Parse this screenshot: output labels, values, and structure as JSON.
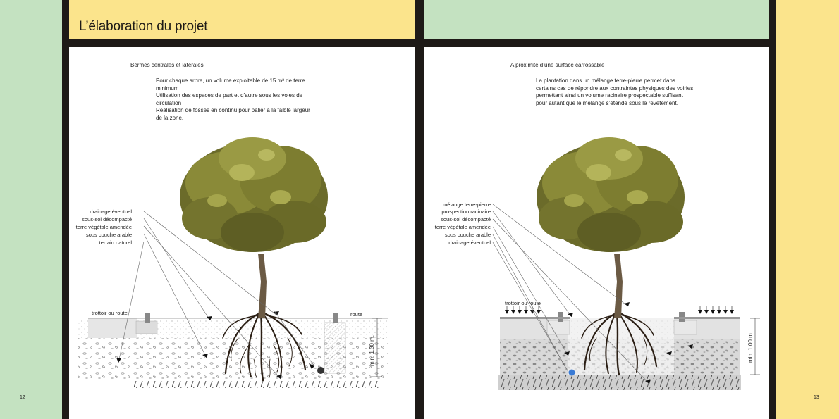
{
  "header": {
    "title": "L’élaboration du projet"
  },
  "left_page": {
    "subtitle": "Bermes centrales et latérales",
    "bullets": [
      "Pour chaque arbre, un volume exploitable de 15 m³ de terre",
      "minimum",
      "Utilisation des espaces de part et d’autre sous les voies de",
      "circulation",
      "Réalisation de fosses en continu pour palier à la faible largeur",
      "de la zone."
    ],
    "diagram_labels": {
      "drainage": "drainage éventuel",
      "sous_sol": "sous-sol décompacté",
      "terre_vegetale": "terre végétale amendée",
      "sous_couche": "sous couche arable",
      "terrain": "terrain naturel",
      "trottoir": "trottoir ou route",
      "route": "route",
      "depth": "min. 1.00 m."
    },
    "page_number": "12"
  },
  "right_page": {
    "subtitle": "A proximité d’une surface carrossable",
    "paragraph": [
      "La plantation dans un mélange terre-pierre permet dans",
      "certains cas de répondre aux contraintes physiques des voiries,",
      "permettant ainsi un volume racinaire prospectable suffisant",
      "pour autant que le mélange s’étende sous le revêtement."
    ],
    "diagram_labels": {
      "melange": "mélange terre-pierre",
      "prospection": "prospection racinaire",
      "sous_sol": "sous-sol décompacté",
      "terre_vegetale": "terre végétale amendée",
      "sous_couche": "sous couche arable",
      "drainage": "drainage éventuel",
      "trottoir": "trottoir ou route",
      "depth": "min. 1.00 m."
    },
    "page_number": "13"
  },
  "colors": {
    "green": "#c4e2c1",
    "yellow": "#fbe48c",
    "black": "#1e1a17",
    "drain_left": "#333333",
    "drain_right": "#3a7bd5"
  },
  "icons": [
    "tree-illustration",
    "roots-illustration",
    "drain-pipe-icon",
    "arrow-icon"
  ]
}
